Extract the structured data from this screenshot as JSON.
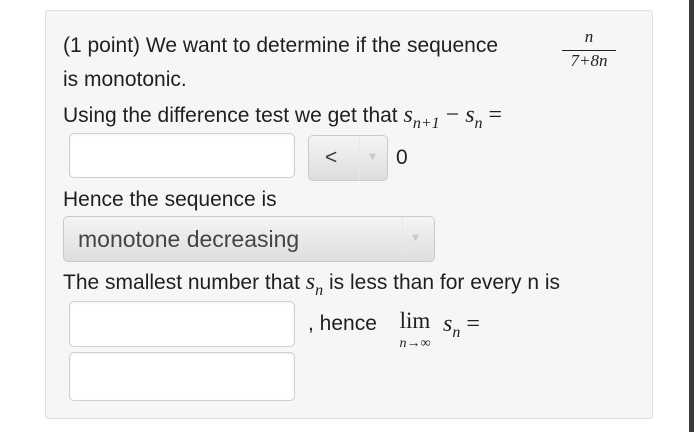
{
  "problem": {
    "intro": "(1 point) We want to determine if the sequence",
    "frac_num": "n",
    "frac_den": "7+8n",
    "intro_end": "is monotonic.",
    "diff_text": "Using the difference test we get that",
    "diff_math_a": "s",
    "diff_math_a_sub": "n+1",
    "diff_op": "−",
    "diff_math_b": "s",
    "diff_math_b_sub": "n",
    "diff_eq": "=",
    "ineq_value": "<",
    "zero": "0",
    "hence_text": "Hence the sequence is",
    "sequence_choice": "monotone decreasing",
    "smallest_text_a": "The smallest number that",
    "smallest_s": "s",
    "smallest_sub": "n",
    "smallest_text_b": "is less than for every n is",
    "hence_lim_text": ", hence",
    "lim_word": "lim",
    "lim_sub": "n→∞",
    "lim_s": "s",
    "lim_s_sub": "n",
    "lim_eq": "="
  },
  "inputs": {
    "difference_answer": "",
    "lower_bound_answer": "",
    "limit_answer": ""
  },
  "colors": {
    "card_bg": "#f6f6f6",
    "input_bg": "#ffffff",
    "select_gradient_top": "#f4f4f4",
    "select_gradient_bottom": "#dedede",
    "text": "#1f1f1f"
  },
  "icons": {
    "select_caret": "chevron-down-icon"
  }
}
